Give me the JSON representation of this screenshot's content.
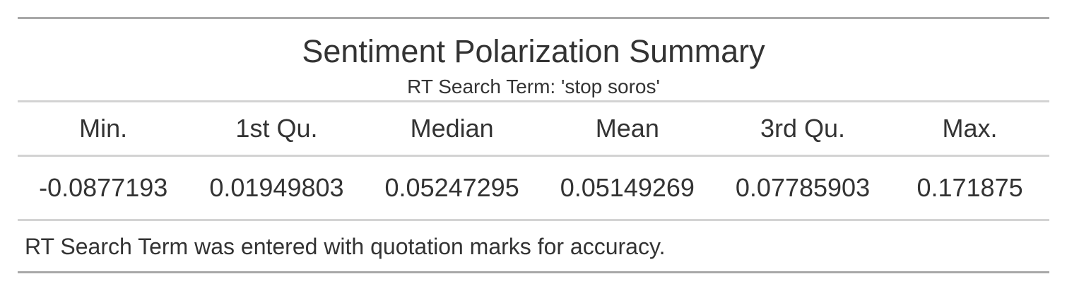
{
  "chart_data": {
    "type": "table",
    "title": "Sentiment Polarization Summary",
    "subtitle": "RT Search Term: 'stop soros'",
    "columns": [
      "Min.",
      "1st Qu.",
      "Median",
      "Mean",
      "3rd Qu.",
      "Max."
    ],
    "rows": [
      [
        "-0.0877193",
        "0.01949803",
        "0.05247295",
        "0.05149269",
        "0.07785903",
        "0.171875"
      ]
    ],
    "footnote": "RT Search Term was entered with quotation marks for accuracy."
  },
  "colors": {
    "text": "#333333",
    "outer_rule": "#a8a8a8",
    "inner_rule": "#d3d3d3",
    "background": "#ffffff"
  }
}
